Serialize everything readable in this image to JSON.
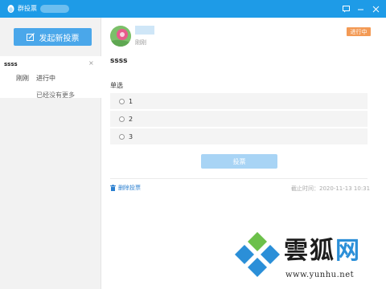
{
  "window": {
    "title": "群投票"
  },
  "sidebar": {
    "new_vote_label": "发起新投票",
    "items": [
      {
        "name": "ssss",
        "time": "刚刚",
        "status": "进行中"
      }
    ],
    "no_more_text": "已经没有更多"
  },
  "vote": {
    "posted_time": "刚刚",
    "status_badge": "进行中",
    "title": "ssss",
    "type_label": "单选",
    "options": [
      {
        "label": "1"
      },
      {
        "label": "2"
      },
      {
        "label": "3"
      }
    ],
    "submit_label": "投票",
    "delete_label": "删除投票",
    "deadline_text": "截止时间：2020-11-13 10:31"
  },
  "watermark": {
    "brand_main": "雲狐",
    "brand_accent": "网",
    "url": "www.yunhu.net"
  },
  "colors": {
    "titlebar": "#1e9be7",
    "primary_button": "#4aa7ea",
    "disabled_button": "#a8d4f5",
    "badge": "#f39a55",
    "link": "#2a7fd0"
  }
}
